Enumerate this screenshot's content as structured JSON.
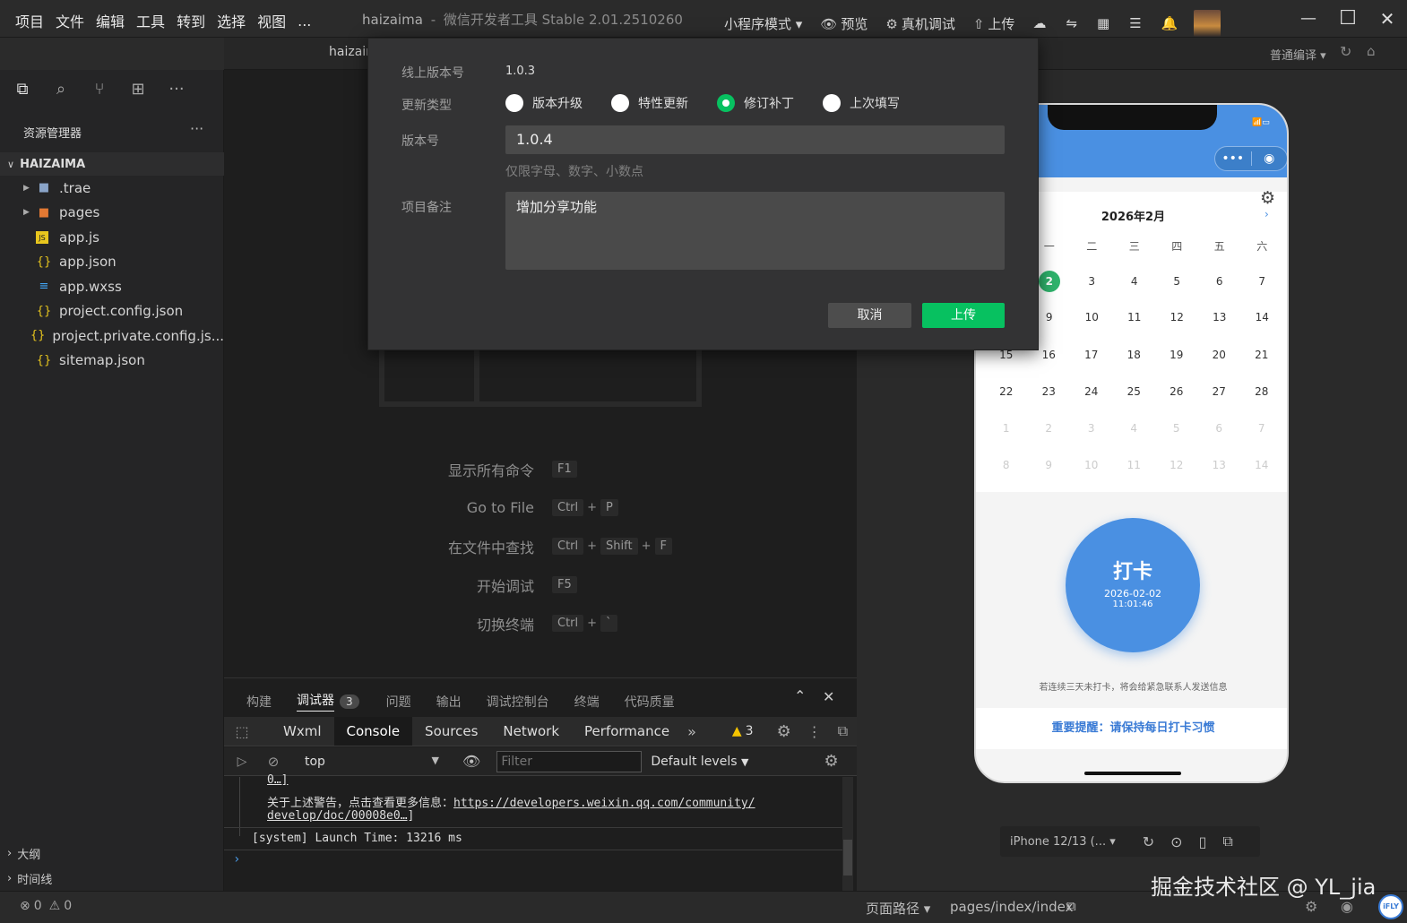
{
  "menubar": [
    "项目",
    "文件",
    "编辑",
    "工具",
    "转到",
    "选择",
    "视图",
    "..."
  ],
  "window_title": {
    "project": "haizaima",
    "app": "微信开发者工具 Stable 2.01.2510260"
  },
  "toolbar": [
    {
      "label": "小程序模式 ▾",
      "icon": ""
    },
    {
      "label": "预览",
      "icon": "👁"
    },
    {
      "label": "真机调试",
      "icon": "⚙"
    },
    {
      "label": "上传",
      "icon": "⇧"
    }
  ],
  "toolbar_icons": [
    "cloud-icon",
    "swap-icon",
    "layout-icon",
    "list-icon",
    "bell-icon"
  ],
  "win_controls": [
    "—",
    "☐",
    "✕"
  ],
  "second_bar": {
    "tab": "haizair",
    "compile_mode": "普通编译 ▾"
  },
  "sidebar": {
    "header": "资源管理器",
    "more": "···",
    "root": "HAIZAIMA",
    "files": [
      {
        "name": ".trae",
        "icon": "folder",
        "type": "dir"
      },
      {
        "name": "pages",
        "icon": "folder-pages",
        "type": "dir"
      },
      {
        "name": "app.js",
        "icon": "js",
        "type": "file"
      },
      {
        "name": "app.json",
        "icon": "json",
        "type": "file"
      },
      {
        "name": "app.wxss",
        "icon": "css",
        "type": "file"
      },
      {
        "name": "project.config.json",
        "icon": "json",
        "type": "file"
      },
      {
        "name": "project.private.config.js...",
        "icon": "json",
        "type": "file"
      },
      {
        "name": "sitemap.json",
        "icon": "json",
        "type": "file"
      }
    ],
    "outline": "大纲",
    "timeline": "时间线"
  },
  "commands": [
    {
      "label": "显示所有命令",
      "keys": [
        "F1"
      ]
    },
    {
      "label": "Go to File",
      "keys": [
        "Ctrl",
        "P"
      ]
    },
    {
      "label": "在文件中查找",
      "keys": [
        "Ctrl",
        "Shift",
        "F"
      ]
    },
    {
      "label": "开始调试",
      "keys": [
        "F5"
      ]
    },
    {
      "label": "切换终端",
      "keys": [
        "Ctrl",
        "`"
      ]
    }
  ],
  "panel": {
    "tabs": [
      "构建",
      "调试器",
      "问题",
      "输出",
      "调试控制台",
      "终端",
      "代码质量"
    ],
    "debugger_badge": "3",
    "devtools_tabs": [
      "Wxml",
      "Console",
      "Sources",
      "Network",
      "Performance"
    ],
    "warn_count": "3",
    "context": "top",
    "filter_placeholder": "Filter",
    "levels": "Default levels",
    "log_truncated": "0…]",
    "log_warning_text": "关于上述警告，点击查看更多信息：",
    "log_link_1": "https://developers.weixin.qq.com/community/",
    "log_link_2": "develop/doc/00008e0…",
    "log_link_end": "]",
    "log_system": "[system] Launch Time: 13216 ms",
    "prompt": "›"
  },
  "phone": {
    "calendar_title": "2026年2月",
    "next": "›",
    "weekdays": [
      "一",
      "二",
      "三",
      "四",
      "五",
      "六"
    ],
    "rows": [
      [
        "2",
        "3",
        "4",
        "5",
        "6",
        "7"
      ],
      [
        "9",
        "10",
        "11",
        "12",
        "13",
        "14"
      ],
      [
        "16",
        "17",
        "18",
        "19",
        "20",
        "21"
      ],
      [
        "22",
        "23",
        "24",
        "25",
        "26",
        "27",
        "28"
      ],
      [
        "1",
        "2",
        "3",
        "4",
        "5",
        "6",
        "7"
      ],
      [
        "8",
        "9",
        "10",
        "11",
        "12",
        "13",
        "14"
      ]
    ],
    "row3_lead": "15",
    "checkin_label": "打卡",
    "checkin_date": "2026-02-02",
    "checkin_time": "11:01:46",
    "notice": "若连续三天未打卡，将会给紧急联系人发送信息",
    "reminder": "重要提醒：请保持每日打卡习惯",
    "accent": "#4a90e2"
  },
  "sim_bar": {
    "device": "iPhone 12/13 (... ▾"
  },
  "status": {
    "errors": "0",
    "warnings": "0",
    "page_path_label": "页面路径 ▾",
    "page_path": "pages/index/index"
  },
  "watermark": "掘金技术社区 @ YL_jia",
  "dialog": {
    "online_version_label": "线上版本号",
    "online_version": "1.0.3",
    "update_type_label": "更新类型",
    "update_types": [
      {
        "label": "版本升级",
        "selected": false
      },
      {
        "label": "特性更新",
        "selected": false
      },
      {
        "label": "修订补丁",
        "selected": true
      },
      {
        "label": "上次填写",
        "selected": false
      }
    ],
    "version_label": "版本号",
    "version_value": "1.0.4",
    "version_hint": "仅限字母、数字、小数点",
    "note_label": "项目备注",
    "note_value": "增加分享功能",
    "cancel": "取消",
    "upload": "上传",
    "upload_color": "#07c160"
  }
}
